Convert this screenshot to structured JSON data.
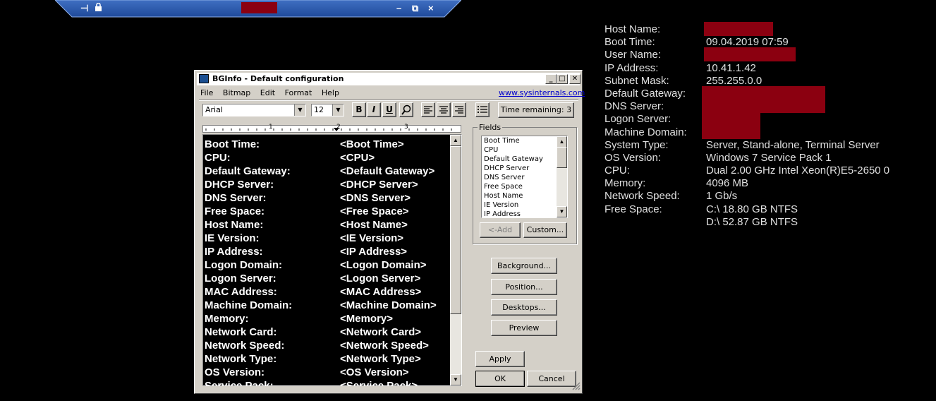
{
  "rdp_bar": {
    "pin_icon": "pin-icon",
    "lock_icon": "lock-icon",
    "minimize": "–",
    "restore": "⧉",
    "close": "×"
  },
  "desktop_info": [
    {
      "label": "Host Name:",
      "value": "",
      "redacted": true
    },
    {
      "label": "Boot Time:",
      "value": "09.04.2019 07:59"
    },
    {
      "label": "User Name:",
      "value": "",
      "redacted": true
    },
    {
      "label": "IP Address:",
      "value": "10.41.1.42"
    },
    {
      "label": "Subnet Mask:",
      "value": "255.255.0.0"
    },
    {
      "label": "Default Gateway:",
      "value": "",
      "redacted": true
    },
    {
      "label": "DNS Server:",
      "value": "",
      "redacted": true
    },
    {
      "label": "Logon Server:",
      "value": "",
      "redacted": true
    },
    {
      "label": "Machine Domain:",
      "value": "",
      "redacted": true
    },
    {
      "label": "System Type:",
      "value": "Server, Stand-alone, Terminal Server"
    },
    {
      "label": "OS Version:",
      "value": "Windows 7 Service Pack 1"
    },
    {
      "label": "CPU:",
      "value": "Dual 2.00 GHz Intel Xeon(R)E5-2650 0"
    },
    {
      "label": "Memory:",
      "value": "4096 MB"
    },
    {
      "label": "Network Speed:",
      "value": "1 Gb/s"
    },
    {
      "label": "Free Space:",
      "value": "C:\\ 18.80 GB NTFS"
    },
    {
      "label": "",
      "value": "D:\\ 52.87 GB NTFS"
    }
  ],
  "window": {
    "title": "BGInfo - Default configuration",
    "menu": [
      "File",
      "Bitmap",
      "Edit",
      "Format",
      "Help"
    ],
    "link": "www.sysinternals.com",
    "font_name": "Arial",
    "font_size": "12",
    "format_buttons": {
      "bold": "B",
      "italic": "I",
      "underline": "U"
    },
    "time_remaining": "Time remaining: 3",
    "ruler_marks": [
      "1",
      "2",
      "3"
    ],
    "editor_rows": [
      {
        "key": "Boot Time:",
        "value": "<Boot Time>"
      },
      {
        "key": "CPU:",
        "value": "<CPU>"
      },
      {
        "key": "Default Gateway:",
        "value": "<Default Gateway>"
      },
      {
        "key": "DHCP Server:",
        "value": "<DHCP Server>"
      },
      {
        "key": "DNS Server:",
        "value": "<DNS Server>"
      },
      {
        "key": "Free Space:",
        "value": "<Free Space>"
      },
      {
        "key": "Host Name:",
        "value": "<Host Name>"
      },
      {
        "key": "IE Version:",
        "value": "<IE Version>"
      },
      {
        "key": "IP Address:",
        "value": "<IP Address>"
      },
      {
        "key": "Logon Domain:",
        "value": "<Logon Domain>"
      },
      {
        "key": "Logon Server:",
        "value": "<Logon Server>"
      },
      {
        "key": "MAC Address:",
        "value": "<MAC Address>"
      },
      {
        "key": "Machine Domain:",
        "value": "<Machine Domain>"
      },
      {
        "key": "Memory:",
        "value": "<Memory>"
      },
      {
        "key": "Network Card:",
        "value": "<Network Card>"
      },
      {
        "key": "Network Speed:",
        "value": "<Network Speed>"
      },
      {
        "key": "Network Type:",
        "value": "<Network Type>"
      },
      {
        "key": "OS Version:",
        "value": "<OS Version>"
      },
      {
        "key": "Service Pack:",
        "value": "<Service Pack>"
      }
    ],
    "fields_label": "Fields",
    "fields_list": [
      "Boot Time",
      "CPU",
      "Default Gateway",
      "DHCP Server",
      "DNS Server",
      "Free Space",
      "Host Name",
      "IE Version",
      "IP Address"
    ],
    "add_button": "<-Add",
    "custom_button": "Custom...",
    "background_button": "Background...",
    "position_button": "Position...",
    "desktops_button": "Desktops...",
    "preview_button": "Preview",
    "apply_button": "Apply",
    "ok_button": "OK",
    "cancel_button": "Cancel"
  },
  "colors": {
    "redaction": "#8b0010",
    "desktop": "#000000",
    "dialog_face": "#d4d0c8"
  }
}
